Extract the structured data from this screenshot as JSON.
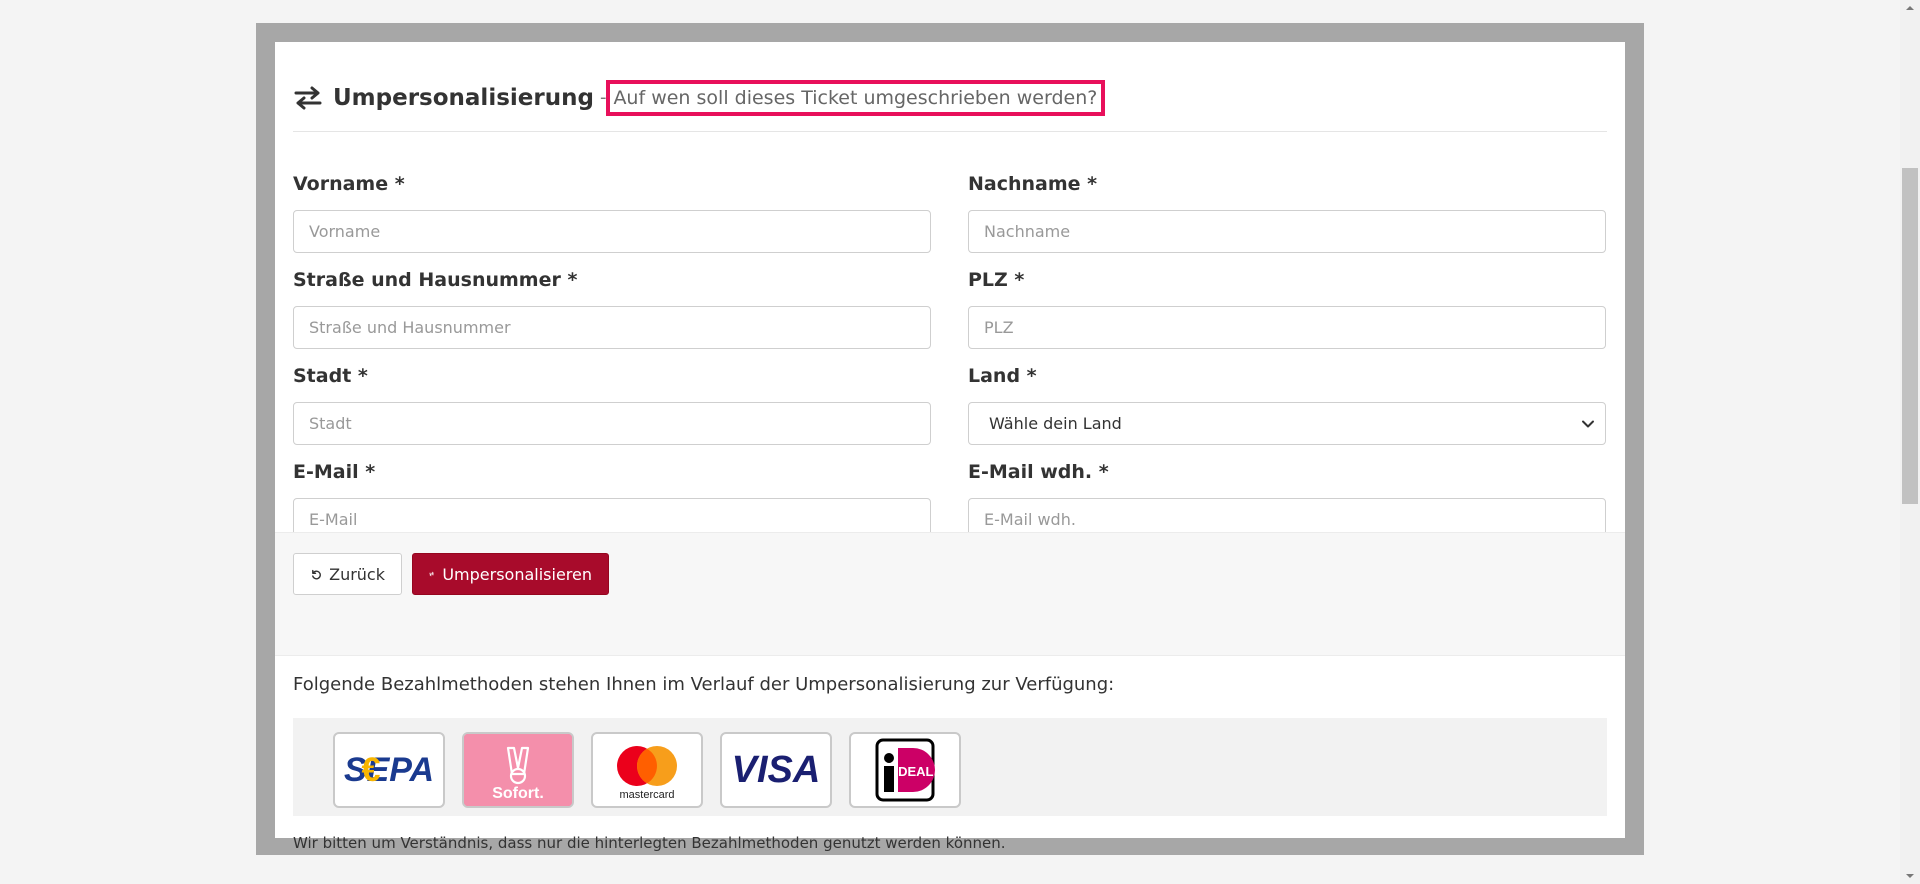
{
  "header": {
    "title": "Umpersonalisierung",
    "separator": "-",
    "subtitle": "Auf wen soll dieses Ticket umgeschrieben werden?"
  },
  "form": {
    "vorname": {
      "label": "Vorname *",
      "placeholder": "Vorname"
    },
    "nachname": {
      "label": "Nachname *",
      "placeholder": "Nachname"
    },
    "strasse": {
      "label": "Straße und Hausnummer *",
      "placeholder": "Straße und Hausnummer"
    },
    "plz": {
      "label": "PLZ *",
      "placeholder": "PLZ"
    },
    "stadt": {
      "label": "Stadt *",
      "placeholder": "Stadt"
    },
    "land": {
      "label": "Land *",
      "selected": "Wähle dein Land"
    },
    "email": {
      "label": "E-Mail *",
      "placeholder": "E-Mail"
    },
    "email_repeat": {
      "label": "E-Mail wdh. *",
      "placeholder": "E-Mail wdh."
    }
  },
  "actions": {
    "back_label": "Zurück",
    "submit_label": "Umpersonalisieren"
  },
  "payment": {
    "intro": "Folgende Bezahlmethoden stehen Ihnen im Verlauf der Umpersonalisierung zur Verfügung:",
    "note": "Wir bitten um Verständnis, dass nur die hinterlegten Bezahlmethoden genutzt werden können.",
    "methods": [
      "SEPA",
      "Sofort.",
      "mastercard",
      "VISA",
      "iDEAL"
    ]
  },
  "colors": {
    "accent": "#a80b2b",
    "highlight": "#e8105b",
    "frame": "#a7a7a7"
  }
}
